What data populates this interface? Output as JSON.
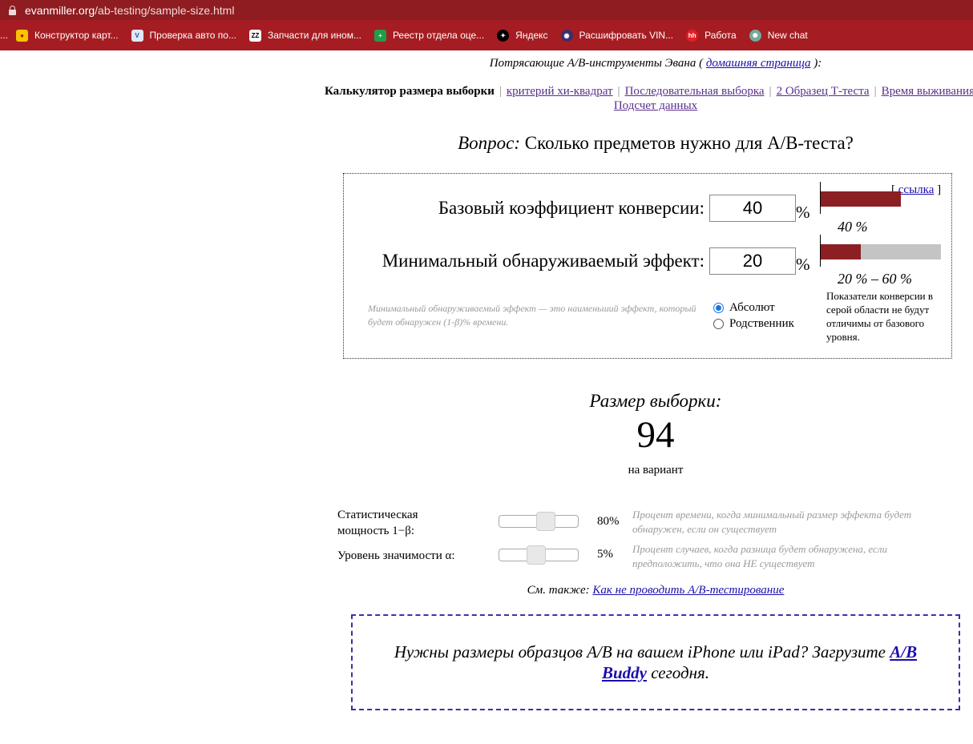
{
  "browser": {
    "url_host": "evanmiller.org",
    "url_path": "/ab-testing/sample-size.html",
    "bookmarks": [
      {
        "label": "...",
        "icon": "overflow-icon"
      },
      {
        "label": "Конструктор карт...",
        "icon": "map-pin-icon"
      },
      {
        "label": "Проверка авто по...",
        "icon": "shield-check-icon"
      },
      {
        "label": "Запчасти для ином...",
        "icon": "zz-icon"
      },
      {
        "label": "Реестр отдела оце...",
        "icon": "spreadsheet-icon"
      },
      {
        "label": "Яндекс",
        "icon": "star-icon"
      },
      {
        "label": "Расшифровать VIN...",
        "icon": "globe-icon"
      },
      {
        "label": "Работа",
        "icon": "hh-icon"
      },
      {
        "label": "New chat",
        "icon": "chatgpt-icon"
      }
    ]
  },
  "page": {
    "tools_prefix": "Потрясающие A/B-инструменты Эвана (",
    "home_link": "домашняя страница",
    "tools_suffix": "):",
    "nav": {
      "current": "Калькулятор размера выборки",
      "links": [
        "критерий хи-квадрат",
        "Последовательная выборка",
        "2 Образец Т-теста",
        "Время выживания",
        "Подсчет данных"
      ]
    },
    "question_prefix": "Вопрос:",
    "question_text": "Сколько предметов нужно для A/B-теста?"
  },
  "calculator": {
    "permalink_open": "[",
    "permalink": "ссылка",
    "permalink_close": "]",
    "baseline_label": "Базовый коэффициент конверсии:",
    "baseline_value": "40",
    "mde_label": "Минимальный обнаруживаемый эффект:",
    "mde_value": "20",
    "pct_symbol": "%",
    "baseline_caption": "40 %",
    "mde_caption": "20 % – 60 %",
    "baseline_fraction": 0.4,
    "mde_low_fraction": 0.2,
    "mde_high_fraction": 0.6,
    "hint": "Минимальный обнаруживаемый эффект — это наименьший эффект, который будет обнаружен (1-β)% времени.",
    "radio_absolute": "Абсолют",
    "radio_relative": "Родственник",
    "gray_note": "Показатели конверсии в серой области не будут отличимы от базового уровня.",
    "colors": {
      "bar": "#8b1f23",
      "gray": "#c4c4c4"
    }
  },
  "result": {
    "title": "Размер выборки:",
    "value": "94",
    "unit": "на вариант"
  },
  "params": {
    "power_label": "Статистическая мощность 1−β:",
    "power_value": "80%",
    "power_desc": "Процент времени, когда минимальный размер эффекта будет обнаружен, если он существует",
    "power_fraction": 0.6,
    "alpha_label": "Уровень значимости α:",
    "alpha_value": "5%",
    "alpha_desc": "Процент случаев, когда разница будет обнаружена, если предположить, что она НЕ существует",
    "alpha_fraction": 0.45
  },
  "footer": {
    "see_also_prefix": "См. также:",
    "see_also_link": "Как не проводить A/B-тестирование",
    "promo_text": "Нужны размеры образцов A/B на вашем iPhone или iPad? Загрузите",
    "promo_link": "A/B Buddy",
    "promo_suffix": "сегодня."
  }
}
